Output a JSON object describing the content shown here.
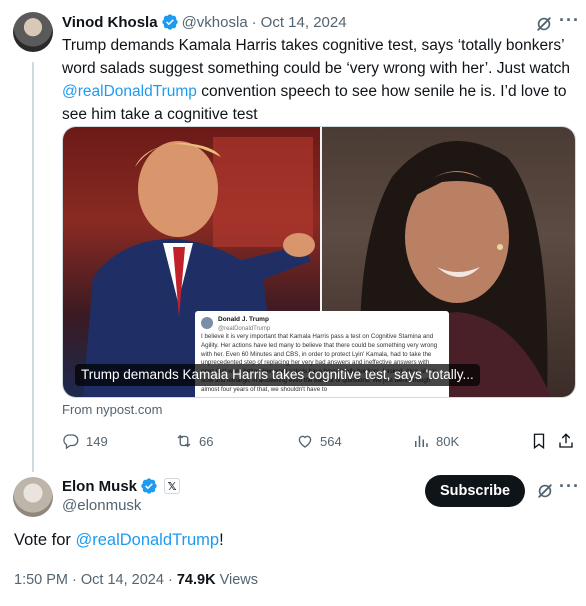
{
  "tweet": {
    "author_name": "Vinod Khosla",
    "author_handle": "@vkhosla",
    "separator": "·",
    "date": "Oct 14, 2024",
    "text_part1": "Trump demands Kamala Harris takes cognitive test, says ‘totally bonkers’ word salads suggest something could be ‘very wrong with her’. Just watch ",
    "mention": "@realDonaldTrump",
    "text_part2": " convention speech to see how senile he is. I’d love to see him take a cognitive test",
    "media": {
      "caption": "Trump demands Kamala Harris takes cognitive test, says 'totally...",
      "embedded_post": {
        "name": "Donald J. Trump",
        "handle": "@realDonaldTrump",
        "body": "I believe it is very important that Kamala Harris pass a test on Cognitive Stamina and Agility. Her actions have led many to believe that there could be something very wrong with her. Even 60 Minutes and CBS, in order to protect Lyin' Kamala, had to take the unprecedented step of replacing her very bad answers and ineffective answers with ones that were better. Her word salads have been totally bonkers. I asked. Also, she is slow and lethargic in answering even the easiest of questions. We just went through almost four years of that, we shouldn't have to"
      }
    },
    "source": "From nypost.com",
    "stats": {
      "replies": "149",
      "reposts": "66",
      "likes": "564",
      "views": "80K"
    }
  },
  "reply": {
    "author_name": "Elon Musk",
    "author_handle": "@elonmusk",
    "affiliate_badge": "𝕏",
    "subscribe_label": "Subscribe",
    "text_prefix": "Vote for ",
    "mention": "@realDonaldTrump",
    "text_suffix": "!",
    "time": "1:50 PM",
    "separator": "·",
    "date": "Oct 14, 2024",
    "dot": "·",
    "views_count": "74.9K",
    "views_label": "Views"
  },
  "icons": {
    "verified": "verified-badge-icon",
    "grok": "grok-icon",
    "more": "more-icon",
    "reply": "reply-icon",
    "repost": "repost-icon",
    "like": "heart-icon",
    "views": "views-chart-icon",
    "bookmark": "bookmark-icon",
    "share": "share-icon"
  },
  "colors": {
    "accent": "#1d9bf0",
    "text": "#0f1419",
    "muted": "#536471",
    "border": "#cfd9de"
  }
}
